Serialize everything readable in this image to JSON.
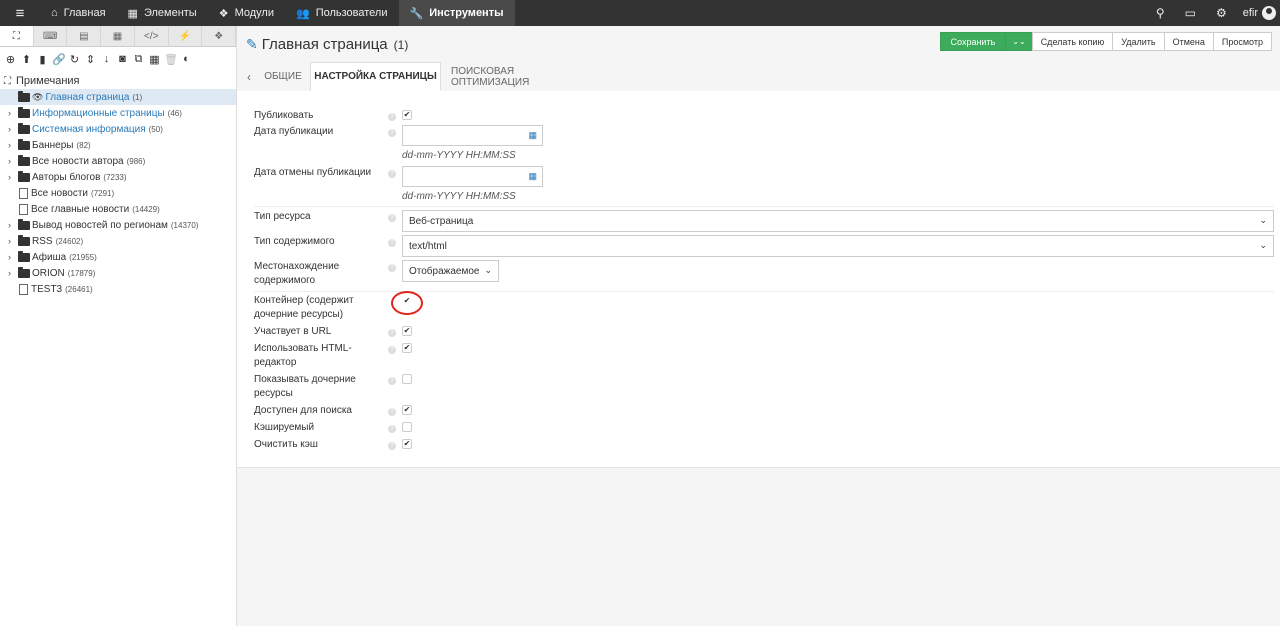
{
  "topbar": {
    "menu_icon": "hamburger-icon",
    "nav": [
      {
        "icon": "home-icon",
        "label": "Главная"
      },
      {
        "icon": "grid-icon",
        "label": "Элементы"
      },
      {
        "icon": "cubes-icon",
        "label": "Модули"
      },
      {
        "icon": "users-icon",
        "label": "Пользователи"
      },
      {
        "icon": "wrench-icon",
        "label": "Инструменты"
      }
    ],
    "active_index": 4,
    "username": "efir"
  },
  "sidebar": {
    "tabs": [
      "sitemap-icon",
      "keyboard-icon",
      "table-icon",
      "grid-icon",
      "code-icon",
      "plug-icon",
      "cubes-icon"
    ],
    "tools": [
      "new-icon",
      "upload-icon",
      "file-icon",
      "link-icon",
      "refresh-icon",
      "sort-icon",
      "sort-num-icon",
      "camera-icon",
      "copy-icon",
      "grid-icon",
      "trash-icon",
      "contrast-icon"
    ],
    "root_label": "Примечания",
    "items": [
      {
        "label": "Главная страница",
        "count": "(1)",
        "type": "folder",
        "caret": false,
        "selected": true,
        "link": true,
        "eye": true
      },
      {
        "label": "Информационные страницы",
        "count": "(46)",
        "type": "folder",
        "caret": true,
        "link": true
      },
      {
        "label": "Системная информация",
        "count": "(50)",
        "type": "folder",
        "caret": true,
        "link": true
      },
      {
        "label": "Баннеры",
        "count": "(82)",
        "type": "folder",
        "caret": true
      },
      {
        "label": "Все новости автора",
        "count": "(986)",
        "type": "folder",
        "caret": true
      },
      {
        "label": "Авторы блогов",
        "count": "(7233)",
        "type": "folder",
        "caret": true
      },
      {
        "label": "Все новости",
        "count": "(7291)",
        "type": "doc",
        "caret": false
      },
      {
        "label": "Все главные новости",
        "count": "(14429)",
        "type": "doc",
        "caret": false
      },
      {
        "label": "Вывод новостей по регионам",
        "count": "(14370)",
        "type": "folder",
        "caret": true
      },
      {
        "label": "RSS",
        "count": "(24602)",
        "type": "folder",
        "caret": true
      },
      {
        "label": "Афиша",
        "count": "(21955)",
        "type": "folder",
        "caret": true
      },
      {
        "label": "ORION",
        "count": "(17879)",
        "type": "folder",
        "caret": true
      },
      {
        "label": "TEST3",
        "count": "(26461)",
        "type": "doc",
        "caret": false
      }
    ]
  },
  "header": {
    "title": "Главная страница",
    "id": "(1)",
    "buttons": {
      "save": "Сохранить",
      "copy": "Сделать копию",
      "delete": "Удалить",
      "cancel": "Отмена",
      "preview": "Просмотр"
    }
  },
  "tabs": {
    "back_icon": "chevron-left-icon",
    "general": "ОБЩИЕ",
    "page_settings": "НАСТРОЙКА СТРАНИЦЫ",
    "seo": "ПОИСКОВАЯ ОПТИМИЗАЦИЯ"
  },
  "form": {
    "published": {
      "label": "Публиковать",
      "checked": true
    },
    "pub_date": {
      "label": "Дата публикации",
      "value": "",
      "hint": "dd-mm-YYYY HH:MM:SS"
    },
    "unpub_date": {
      "label": "Дата отмены публикации",
      "value": "",
      "hint": "dd-mm-YYYY HH:MM:SS"
    },
    "resource_type": {
      "label": "Тип ресурса",
      "value": "Веб-страница"
    },
    "content_type": {
      "label": "Тип содержимого",
      "value": "text/html"
    },
    "content_disposition": {
      "label": "Местонахождение содержимого",
      "value": "Отображаемое"
    },
    "container": {
      "label": "Контейнер (содержит дочерние ресурсы)",
      "checked": true
    },
    "uri_override": {
      "label": "Участвует в URL",
      "checked": true
    },
    "richtext": {
      "label": "Использовать HTML-редактор",
      "checked": true
    },
    "show_children": {
      "label": "Показывать дочерние ресурсы",
      "checked": false
    },
    "searchable": {
      "label": "Доступен для поиска",
      "checked": true
    },
    "cacheable": {
      "label": "Кэшируемый",
      "checked": false
    },
    "clear_cache": {
      "label": "Очистить кэш",
      "checked": true
    }
  },
  "annotation_color": "#e2231a",
  "accent_color": "#3cac5c"
}
